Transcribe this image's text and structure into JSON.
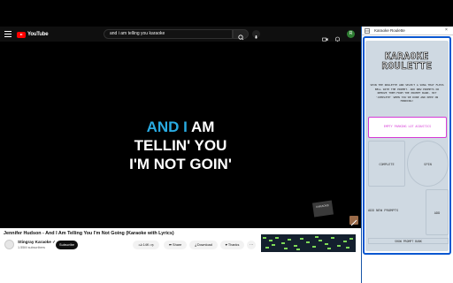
{
  "youtube": {
    "logo_text": "YouTube",
    "search_value": "and i am telling you karaoke",
    "avatar_letter": "R"
  },
  "video": {
    "lyric_line1_highlight": "AND I",
    "lyric_line1_rest": " AM",
    "lyric_line2": "TELLIN' YOU",
    "lyric_line3": "I'M NOT GOIN'",
    "watermark_text": "KARAOKE"
  },
  "details": {
    "title": "Jennifer Hudson - And I Am Telling You I'm Not Going (Karaoke with Lyrics)",
    "channel": "Stingray Karaoke ✓",
    "subscribers": "1.55M subscribers",
    "subscribe_label": "Subscribe",
    "likes": "14K",
    "share_label": "Share",
    "download_label": "Download",
    "thanks_label": "Thanks"
  },
  "extension": {
    "panel_title": "Karaoke Roulette",
    "close_glyph": "×",
    "app_title_line1": "KARAOKE",
    "app_title_line2": "ROULETTE",
    "description": "SPIN THE ROULETTE AND SELECT A SONG THAT FLEXS BELL WITH THE PROMPT. ADD NEW PROMPTS OR REMOVE THEM FROM THE PROMPT BANK. HIT 'COMPLETE' WHEN YOU'RE DONE AND KEEP ON MINDING!",
    "current_song": "EMPTY PARKING LOT ACOUSTICS",
    "complete_label": "COMPLETE",
    "spin_label": "SPIN",
    "add_prompts_label": "ADD NEW PROMPTS",
    "add_label": "ADD",
    "show_bank_label": "SHOW PROMPT BANK"
  },
  "colors": {
    "lyric_highlight": "#29abe2",
    "song_accent": "#d63ad6",
    "panel_bg": "#cfd9e2",
    "frame_blue": "#0b57d0"
  }
}
